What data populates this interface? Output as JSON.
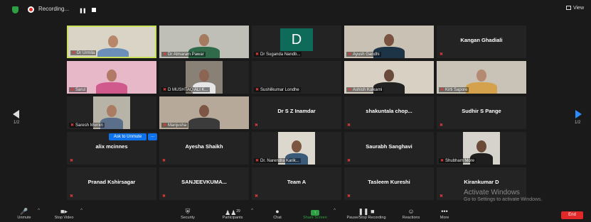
{
  "topbar": {
    "recording_label": "Recording...",
    "view_label": "View"
  },
  "tiles": [
    {
      "name": "Dr Urmila",
      "show_center": false
    },
    {
      "name": "Dr Atmaram Pawar",
      "show_center": false
    },
    {
      "name": "Dr Suganda Nandb...",
      "show_center": false,
      "avatar_letter": "D"
    },
    {
      "name": "Ayush Gandhi",
      "show_center": false
    },
    {
      "name": "Kangan Ghadiali",
      "show_center": true
    },
    {
      "name": "Sarul",
      "show_center": false
    },
    {
      "name": "D MUSHTAQ ALI K...",
      "show_center": false
    },
    {
      "name": "Sushilkumar Londhe",
      "show_center": false
    },
    {
      "name": "Ashish Kulkarni",
      "show_center": false
    },
    {
      "name": "Kirti Sapore",
      "show_center": false
    },
    {
      "name": "Saresh Momin",
      "show_center": false
    },
    {
      "name": "Manjusha",
      "show_center": false
    },
    {
      "name": "Dr S Z Inamdar",
      "show_center": true
    },
    {
      "name": "shakuntala chop...",
      "show_center": true
    },
    {
      "name": "Sudhir S Pange",
      "show_center": true
    },
    {
      "name": "alix mcinnes",
      "show_center": true
    },
    {
      "name": "Ayesha Shaikh",
      "show_center": true
    },
    {
      "name": "Dr. Narendra Karik...",
      "show_center": false
    },
    {
      "name": "Saurabh Sanghavi",
      "show_center": true
    },
    {
      "name": "Shubham More",
      "show_center": false
    },
    {
      "name": "Pranad Kshirsagar",
      "show_center": true
    },
    {
      "name": "SANJEEVKUMA...",
      "show_center": true
    },
    {
      "name": "Team A",
      "show_center": true
    },
    {
      "name": "Tasleem Kureshi",
      "show_center": true
    },
    {
      "name": "Kirankumar D",
      "show_center": true
    }
  ],
  "ask_to_unmute": "Ask to Unmute",
  "ask_more": "...",
  "pagination": {
    "left": "1/2",
    "right": "1/2"
  },
  "watermark": {
    "line1": "Activate Windows",
    "line2": "Go to Settings to activate Windows."
  },
  "toolbar": {
    "unmute": "Unmute",
    "stop_video": "Stop Video",
    "security": "Security",
    "participants": "Participants",
    "participants_count": "29",
    "chat": "Chat",
    "share_screen": "Share Screen",
    "pause_recording": "Pause/Stop Recording",
    "reactions": "Reactions",
    "more": "More",
    "end": "End"
  },
  "colors": {
    "active_speaker": "#c8e05b",
    "muted": "#e23b3b",
    "share": "#2ea043",
    "end": "#e02828",
    "accent": "#0e72ed"
  }
}
